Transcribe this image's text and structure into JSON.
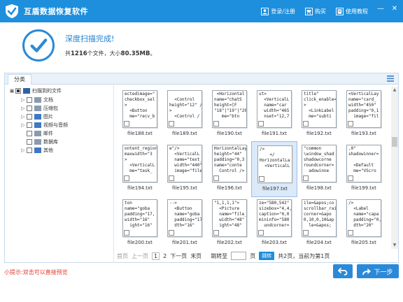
{
  "titlebar": {
    "title": "互盾数据恢复软件",
    "actions": [
      {
        "label": "登录/注册",
        "icon": "user-icon"
      },
      {
        "label": "购买",
        "icon": "cart-icon"
      },
      {
        "label": "使用教程",
        "icon": "book-icon"
      }
    ],
    "window_buttons": [
      "—",
      "✕"
    ],
    "color": "#1d8fdc"
  },
  "status": {
    "title": "深度扫描完成!",
    "prefix": "共",
    "count": "1216",
    "middle": "个文件，大小",
    "size": "80.35MB",
    "suffix": "。"
  },
  "panel": {
    "tab_label": "分类"
  },
  "tree": {
    "items": [
      {
        "label": "扫描到的文件",
        "expander": "▣",
        "level": 0,
        "folder": "open"
      },
      {
        "label": "文档",
        "expander": "▷",
        "level": 1,
        "folder": "grey"
      },
      {
        "label": "压缩包",
        "expander": "▷",
        "level": 1,
        "folder": "grey"
      },
      {
        "label": "图片",
        "expander": "▷",
        "level": 1,
        "folder": "blue"
      },
      {
        "label": "视频与音频",
        "expander": "▷",
        "level": 1,
        "folder": "blue"
      },
      {
        "label": "邮件",
        "expander": "",
        "level": 1,
        "folder": "grey"
      },
      {
        "label": "数据库",
        "expander": "",
        "level": 1,
        "folder": "grey"
      },
      {
        "label": "其他",
        "expander": "▷",
        "level": 1,
        "folder": "blue"
      }
    ]
  },
  "files": [
    {
      "name": "file188.txt",
      "preview": "ectedimage=\"\ncheckbox_sel\n>\n  <Button\n  me=\"recv_b"
    },
    {
      "name": "file189.txt",
      "preview": "\n  <Control\nheight=\"12\" /\n>\n  <Control /"
    },
    {
      "name": "file190.txt",
      "preview": " <Horizontal\nname=\"chatS\nheight=[F\n\"18\"|\"19\"|\"20\"\n   me=\"btn"
    },
    {
      "name": "file191.txt",
      "preview": "ut>\n  <VerticalL\n  name=\"car\n  width=\"465\n  nset=\"12,7"
    },
    {
      "name": "file192.txt",
      "preview": "title\"\nclick_enable=\n>\n  <LinkLabel\n  me=\"subti"
    },
    {
      "name": "file193.txt",
      "preview": "<VerticalLay\nname=\"card_\nwidth=\"450\"\npadding=\"0,1\n  image=\"fil"
    },
    {
      "name": "file194.txt",
      "preview": "ontent_region\nmaxwidth=\"3\n>\n  <VerticalL\n  me=\"task_"
    },
    {
      "name": "file195.txt",
      "preview": "e\"/>\n  <VerticalL\n  name=\"text_\n  width=\"440\"\n  image=\"file"
    },
    {
      "name": "file196.txt",
      "preview": "HorizontalLay\nheight=\"44\"\npadding=\"0,3\nname=\"conte\n  Control />"
    },
    {
      "name": "file197.txt",
      "preview": "/>\n    </\nHorizontalLa\n  <VerticalL\n"
    },
    {
      "name": "file198.txt",
      "preview": "\"common\n\\window_shad\nshadowcorne\nroundcorner=\n  adowinne"
    },
    {
      "name": "file199.txt",
      "preview": ",0\"\nshadowinner=\n\n  <Default\n  me=\"VScro"
    },
    {
      "name": "file200.txt",
      "preview": "ton\nname=\"goba\npadding=\"17,\nwidth=\"16\"\n  ight=\"16\""
    },
    {
      "name": "file201.txt",
      "preview": "-->\n  <Button\n  name=\"goba\n  padding=\"17,\n  dth=\"16\""
    },
    {
      "name": "file202.txt",
      "preview": "\"1,1,1,1\">\n  <Picture\n  name=\"file_ic\n  width=\"48\"\n  ight=\"48\""
    },
    {
      "name": "file203.txt",
      "preview": "ze=\"580,542\"\nsizebox=\"4,4,\ncaption=\"0,0\nmininfo=\"580\n  undcorner="
    },
    {
      "name": "file204.txt",
      "preview": "ile=&apos;co\nscrollbar_rail\ncorner=&apo\n0,10,0,10&ap\n  le=&apos;"
    },
    {
      "name": "file205.txt",
      "preview": "/>\n  <Label\n  name=\"capa\n  padding=\"0,9\n  dth=\"20\""
    }
  ],
  "selected_file": "file197.txt",
  "pager": {
    "first": "首页",
    "prev": "上一页",
    "pages": [
      "1",
      "2"
    ],
    "current_page": "1",
    "next": "下一页",
    "last": "末页",
    "jump_label": "跳转至",
    "page_unit": "页",
    "jump_button": "跳转",
    "summary": "共2页，当前为第1页"
  },
  "footer": {
    "tip": "小提示:双击可以直接预览",
    "next_label": "下一步"
  }
}
